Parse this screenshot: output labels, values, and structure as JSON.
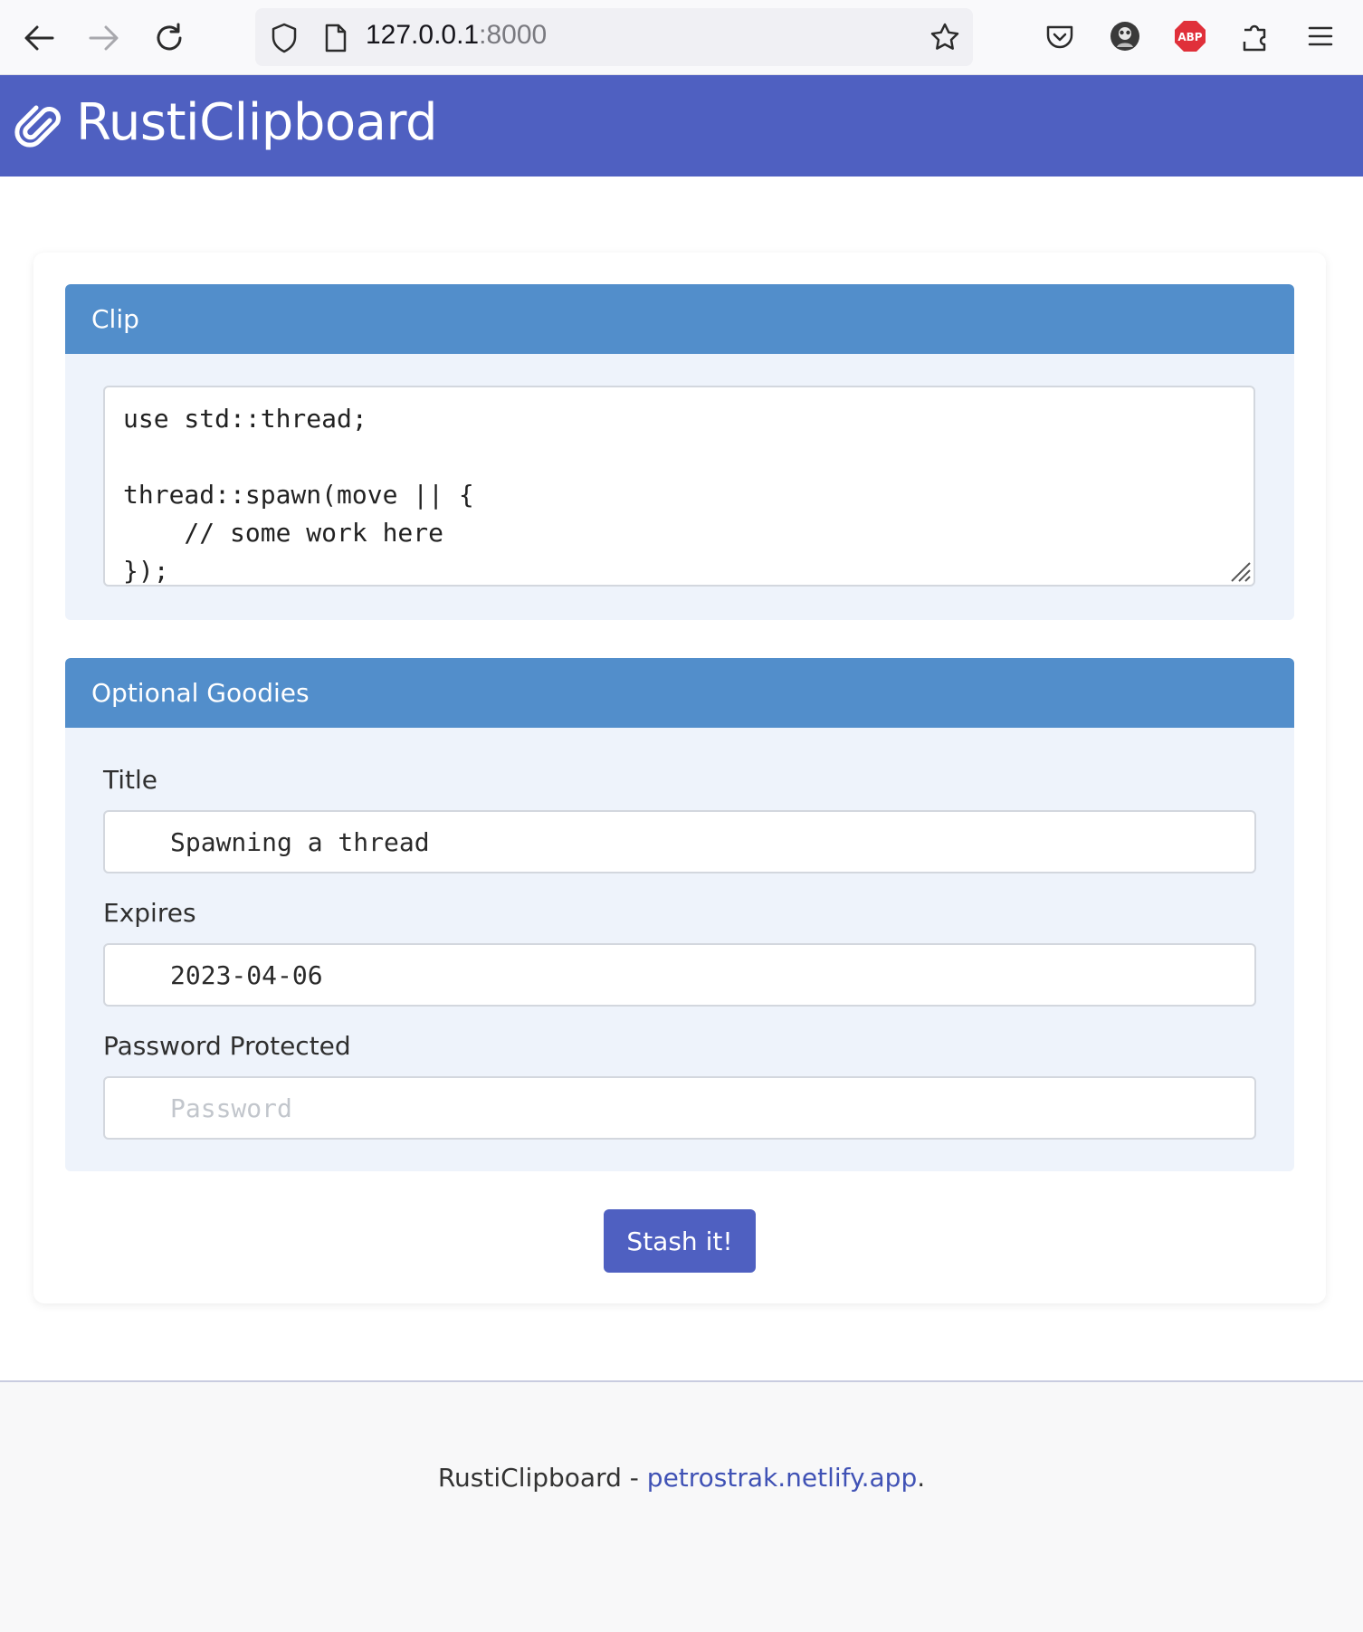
{
  "browser": {
    "url_host": "127.0.0.1",
    "url_port": ":8000",
    "icons": [
      "back-arrow-icon",
      "forward-arrow-icon",
      "reload-icon",
      "shield-icon",
      "page-icon",
      "star-icon",
      "pocket-icon",
      "profile-avatar-icon",
      "adblock-icon",
      "extensions-icon",
      "menu-icon"
    ],
    "adblock_label": "ABP"
  },
  "header": {
    "title": "RustiClipboard",
    "logo_icon": "paperclip-icon",
    "color": "#4f60c1"
  },
  "clip_panel": {
    "heading": "Clip",
    "content": "use std::thread;\n\nthread::spawn(move || {\n    // some work here\n});"
  },
  "goodies_panel": {
    "heading": "Optional Goodies",
    "title_label": "Title",
    "title_value": "Spawning a thread",
    "expires_label": "Expires",
    "expires_value": "2023-04-06",
    "password_label": "Password Protected",
    "password_placeholder": "Password"
  },
  "submit": {
    "label": "Stash it!"
  },
  "footer": {
    "brand": "RustiClipboard",
    "separator": " - ",
    "link_text": "petrostrak.netlify.app",
    "trailing": "."
  },
  "colors": {
    "panel_header": "#528ecb",
    "panel_body": "#eef3fb",
    "accent": "#4f60c1",
    "link": "#4052b5"
  }
}
